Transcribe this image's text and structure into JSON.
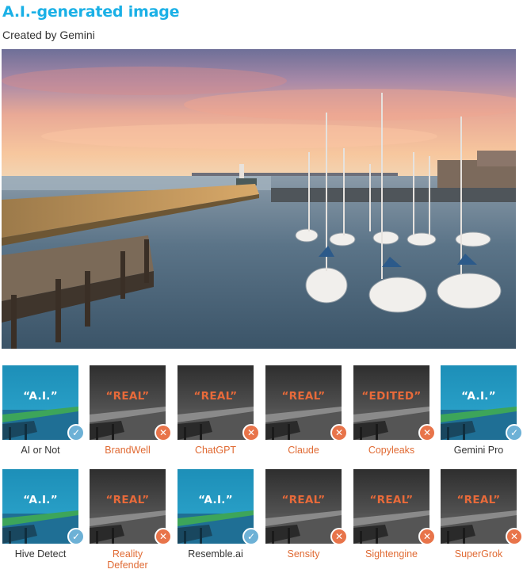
{
  "header": {
    "title": "A.I.-generated image",
    "subtitle": "Created by Gemini"
  },
  "colors": {
    "title": "#1ab0e6",
    "correct": "#6db1d6",
    "incorrect": "#e8744a",
    "label_incorrect": "#e06a33"
  },
  "detectors": [
    {
      "name": "AI or Not",
      "verdict": "“A.I.”",
      "correct": true,
      "icon": "check-icon"
    },
    {
      "name": "BrandWell",
      "verdict": "“REAL”",
      "correct": false,
      "icon": "x-icon"
    },
    {
      "name": "ChatGPT",
      "verdict": "“REAL”",
      "correct": false,
      "icon": "x-icon"
    },
    {
      "name": "Claude",
      "verdict": "“REAL”",
      "correct": false,
      "icon": "x-icon"
    },
    {
      "name": "Copyleaks",
      "verdict": "“EDITED”",
      "correct": false,
      "icon": "x-icon"
    },
    {
      "name": "Gemini Pro",
      "verdict": "“A.I.”",
      "correct": true,
      "icon": "check-icon"
    },
    {
      "name": "Hive Detect",
      "verdict": "“A.I.”",
      "correct": true,
      "icon": "check-icon"
    },
    {
      "name": "Reality Defender",
      "verdict": "“REAL”",
      "correct": false,
      "icon": "x-icon"
    },
    {
      "name": "Resemble.ai",
      "verdict": "“A.I.”",
      "correct": true,
      "icon": "check-icon"
    },
    {
      "name": "Sensity",
      "verdict": "“REAL”",
      "correct": false,
      "icon": "x-icon"
    },
    {
      "name": "Sightengine",
      "verdict": "“REAL”",
      "correct": false,
      "icon": "x-icon"
    },
    {
      "name": "SuperGrok",
      "verdict": "“REAL”",
      "correct": false,
      "icon": "x-icon"
    }
  ]
}
